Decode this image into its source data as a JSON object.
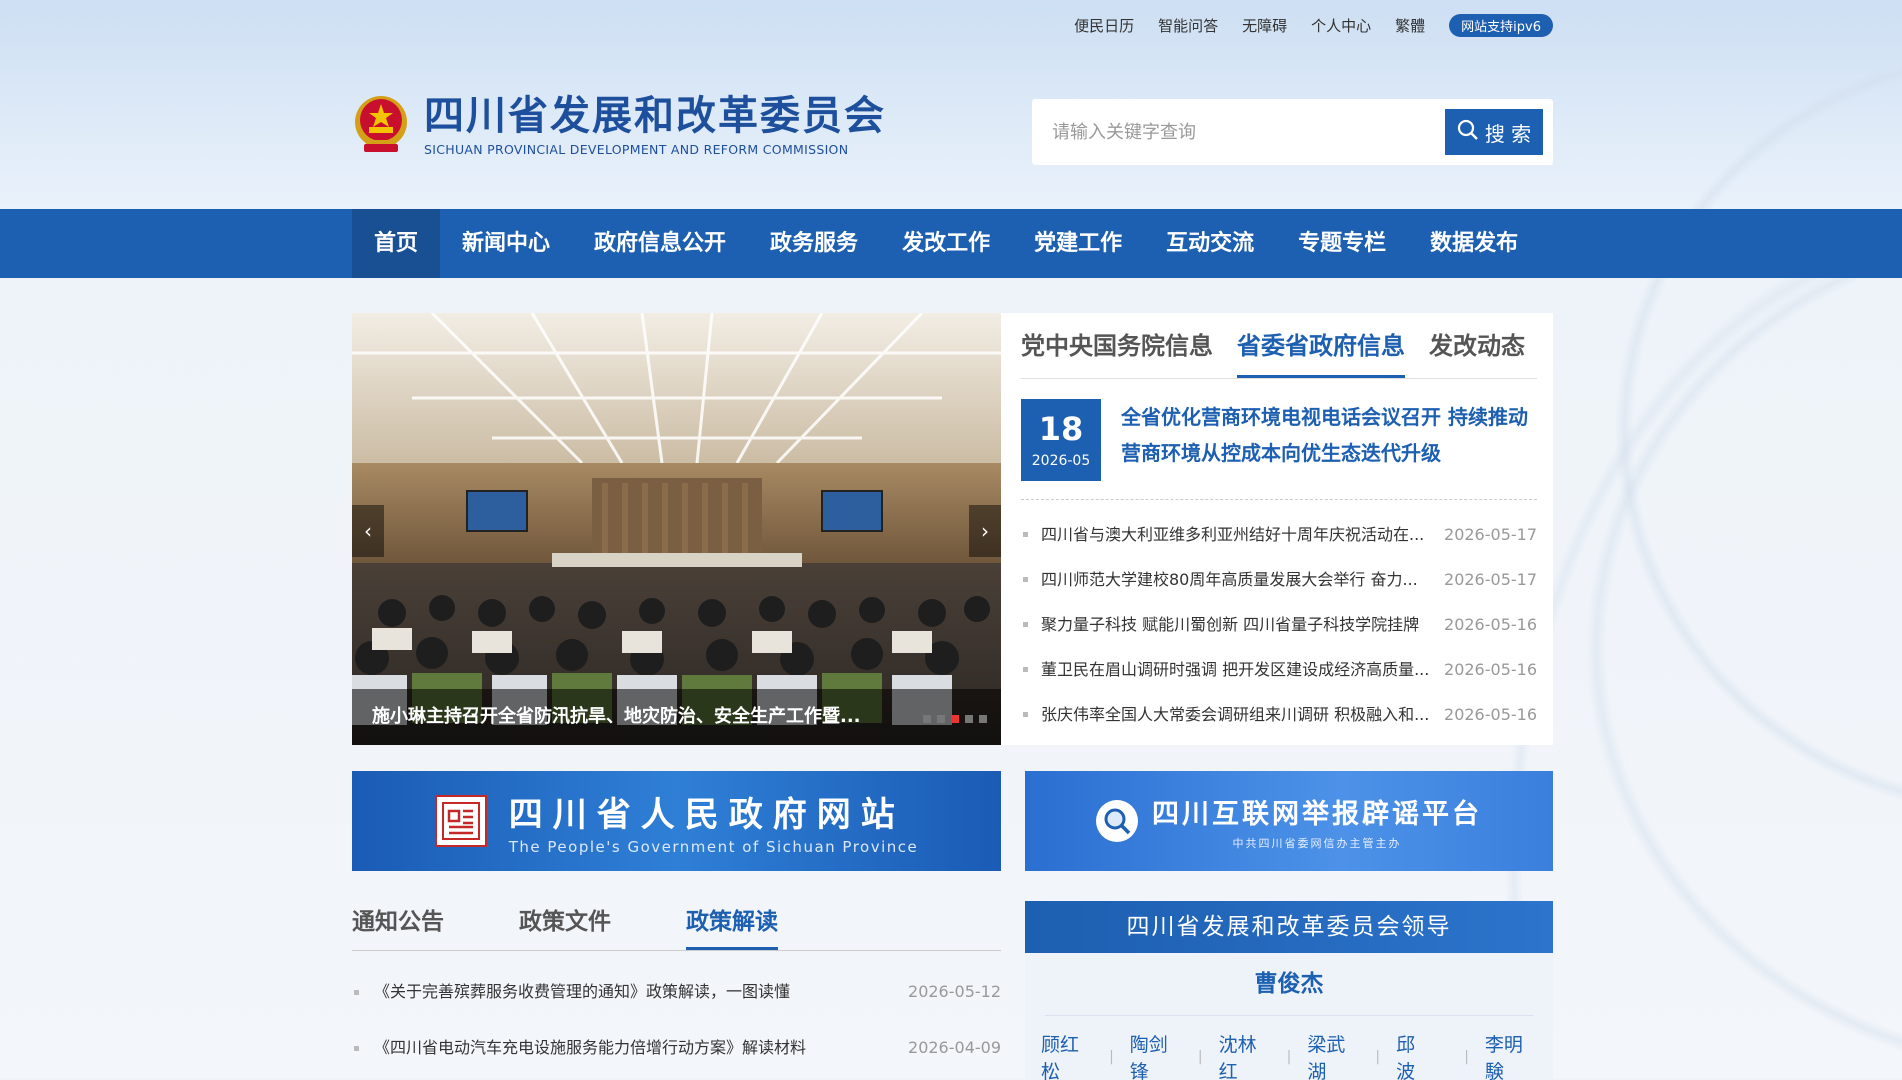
{
  "top_links": [
    "便民日历",
    "智能问答",
    "无障碍",
    "个人中心",
    "繁體"
  ],
  "ipv6_badge": "网站支持ipv6",
  "site": {
    "name_cn": "四川省发展和改革委员会",
    "name_en": "SICHUAN PROVINCIAL DEVELOPMENT AND REFORM COMMISSION"
  },
  "search": {
    "placeholder": "请输入关键字查询",
    "button": "搜 索"
  },
  "nav": [
    "首页",
    "新闻中心",
    "政府信息公开",
    "政务服务",
    "发改工作",
    "党建工作",
    "互动交流",
    "专题专栏",
    "数据发布"
  ],
  "slider": {
    "caption": "施小琳主持召开全省防汛抗旱、地灾防治、安全生产工作暨...",
    "prev": "‹",
    "next": "›",
    "dot_count": 5,
    "active_dot": 3
  },
  "news": {
    "tabs": [
      "党中央国务院信息",
      "省委省政府信息",
      "发改动态"
    ],
    "active_tab": 1,
    "headline": {
      "day": "18",
      "year_month": "2026-05",
      "title": "全省优化营商环境电视电话会议召开 持续推动营商环境从控成本向优生态迭代升级"
    },
    "items": [
      {
        "title": "四川省与澳大利亚维多利亚州结好十周年庆祝活动在...",
        "date": "2026-05-17"
      },
      {
        "title": "四川师范大学建校80周年高质量发展大会举行 奋力...",
        "date": "2026-05-17"
      },
      {
        "title": "聚力量子科技 赋能川蜀创新 四川省量子科技学院挂牌",
        "date": "2026-05-16"
      },
      {
        "title": "董卫民在眉山调研时强调 把开发区建设成经济高质量...",
        "date": "2026-05-16"
      },
      {
        "title": "张庆伟率全国人大常委会调研组来川调研 积极融入和...",
        "date": "2026-05-16"
      }
    ]
  },
  "banner_gov": {
    "title": "四川省人民政府网站",
    "subtitle": "The People's Government of Sichuan Province"
  },
  "banner_report": {
    "title": "四川互联网举报辟谣平台",
    "subtitle": "中共四川省委网信办主管主办"
  },
  "policy": {
    "tabs": [
      "通知公告",
      "政策文件",
      "政策解读"
    ],
    "active_tab": 2,
    "items": [
      {
        "title": "《关于完善殡葬服务收费管理的通知》政策解读，一图读懂",
        "date": "2026-05-12"
      },
      {
        "title": "《四川省电动汽车充电设施服务能力倍增行动方案》解读材料",
        "date": "2026-04-09"
      }
    ]
  },
  "leaders": {
    "title": "四川省发展和改革委员会领导",
    "head": "曹俊杰",
    "members": [
      "顾红松",
      "陶剑锋",
      "沈林红",
      "梁武湖",
      "邱　波",
      "李明験"
    ]
  },
  "colors": {
    "brand_blue": "#1d5fb0",
    "nav_active": "#194f93",
    "dot_active": "#ee3333"
  }
}
